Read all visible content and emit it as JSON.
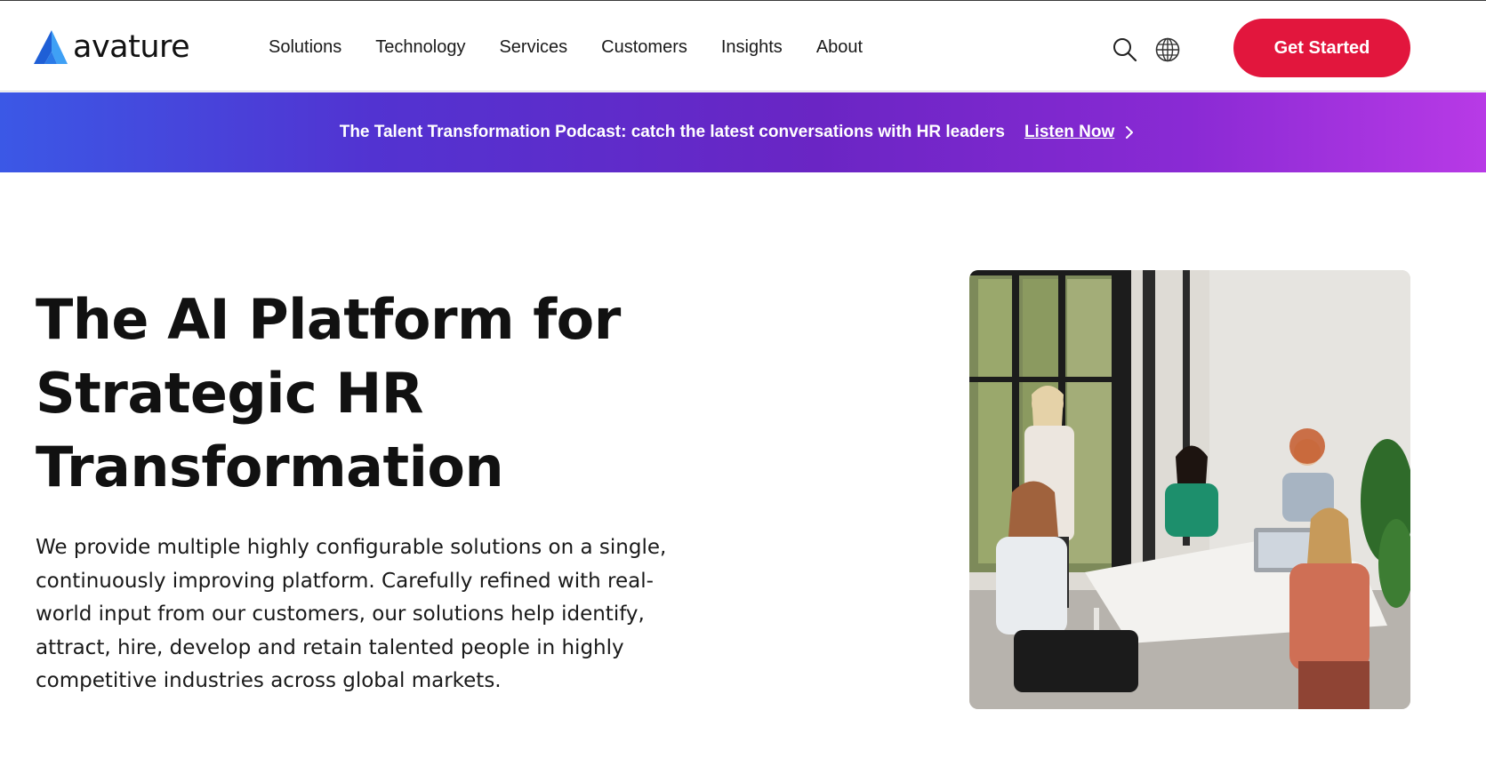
{
  "brand": {
    "name": "avature",
    "colors": {
      "accent": "#e2163d",
      "logo_blue_dark": "#1f5fd6",
      "logo_blue_light": "#3fa0f5"
    }
  },
  "nav": {
    "items": [
      {
        "label": "Solutions"
      },
      {
        "label": "Technology"
      },
      {
        "label": "Services"
      },
      {
        "label": "Customers"
      },
      {
        "label": "Insights"
      },
      {
        "label": "About"
      }
    ]
  },
  "header": {
    "search_icon": "search-icon",
    "globe_icon": "globe-icon",
    "cta_label": "Get Started"
  },
  "banner": {
    "text": "The Talent Transformation Podcast: catch the latest conversations with HR leaders",
    "link_label": "Listen Now",
    "link_icon": "chevron-right-icon"
  },
  "hero": {
    "title_lines": [
      "The AI Platform for",
      "Strategic HR",
      "Transformation"
    ],
    "description_lines": [
      "We provide multiple highly configurable solutions on a single,",
      "continuously improving platform. Carefully refined with real-",
      "world input from our customers, our solutions help identify,",
      "attract, hire, develop and retain talented people in highly",
      "competitive industries across global markets."
    ]
  }
}
